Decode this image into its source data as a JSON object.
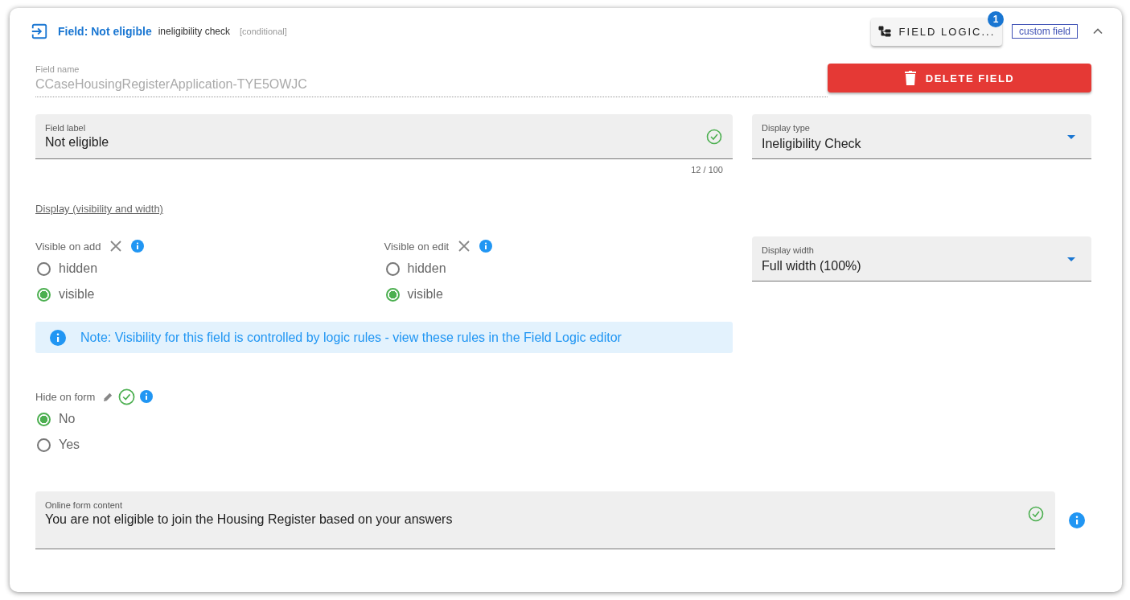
{
  "header": {
    "title": "Field: Not eligible",
    "type": "ineligibility check",
    "condition": "[conditional]",
    "logic_button": {
      "label": "FIELD LOGIC...",
      "badge": "1"
    },
    "tag": "custom field",
    "expanded": true
  },
  "field_name": {
    "label": "Field name",
    "value": "CCaseHousingRegisterApplication-TYE5OWJC"
  },
  "delete_button": "DELETE FIELD",
  "field_label": {
    "label": "Field label",
    "value": "Not eligible",
    "valid": true,
    "counter": "12 / 100"
  },
  "display_type": {
    "label": "Display type",
    "value": "Ineligibility Check"
  },
  "display_link": "Display (visibility and width)",
  "visibility": [
    {
      "label": "Visible on add",
      "options": [
        {
          "label": "hidden",
          "selected": false
        },
        {
          "label": "visible",
          "selected": true
        }
      ]
    },
    {
      "label": "Visible on edit",
      "options": [
        {
          "label": "hidden",
          "selected": false
        },
        {
          "label": "visible",
          "selected": true
        }
      ]
    }
  ],
  "display_width": {
    "label": "Display width",
    "value": "Full width (100%)"
  },
  "note": "Note: Visibility for this field is controlled by logic rules - view these rules in the Field Logic editor",
  "hide_on_form": {
    "label": "Hide on form",
    "valid": true,
    "options": [
      {
        "label": "No",
        "selected": true
      },
      {
        "label": "Yes",
        "selected": false
      }
    ]
  },
  "online_content": {
    "label": "Online form content",
    "value": "You are not eligible to join the Housing Register based on your answers",
    "valid": true
  }
}
